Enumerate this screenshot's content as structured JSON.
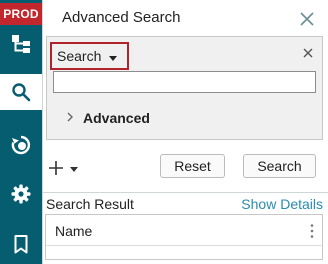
{
  "app": {
    "env_badge": "PROD"
  },
  "rail": {
    "items": [
      {
        "icon": "hierarchy-icon",
        "active": false
      },
      {
        "icon": "search-icon",
        "active": true
      },
      {
        "icon": "refresh-clock-icon",
        "active": false
      },
      {
        "icon": "gear-icon",
        "active": false
      },
      {
        "icon": "bookmark-icon",
        "active": false
      }
    ]
  },
  "panel": {
    "title": "Advanced Search",
    "search": {
      "type_label": "Search",
      "input_value": "",
      "advanced_label": "Advanced"
    },
    "actions": {
      "reset_label": "Reset",
      "search_label": "Search"
    },
    "results": {
      "header": "Search Result",
      "show_details_label": "Show Details",
      "columns": [
        "Name"
      ]
    }
  },
  "colors": {
    "rail": "#075d70",
    "badge": "#c1272d",
    "highlight": "#b0232a",
    "link": "#2a8bb0"
  }
}
